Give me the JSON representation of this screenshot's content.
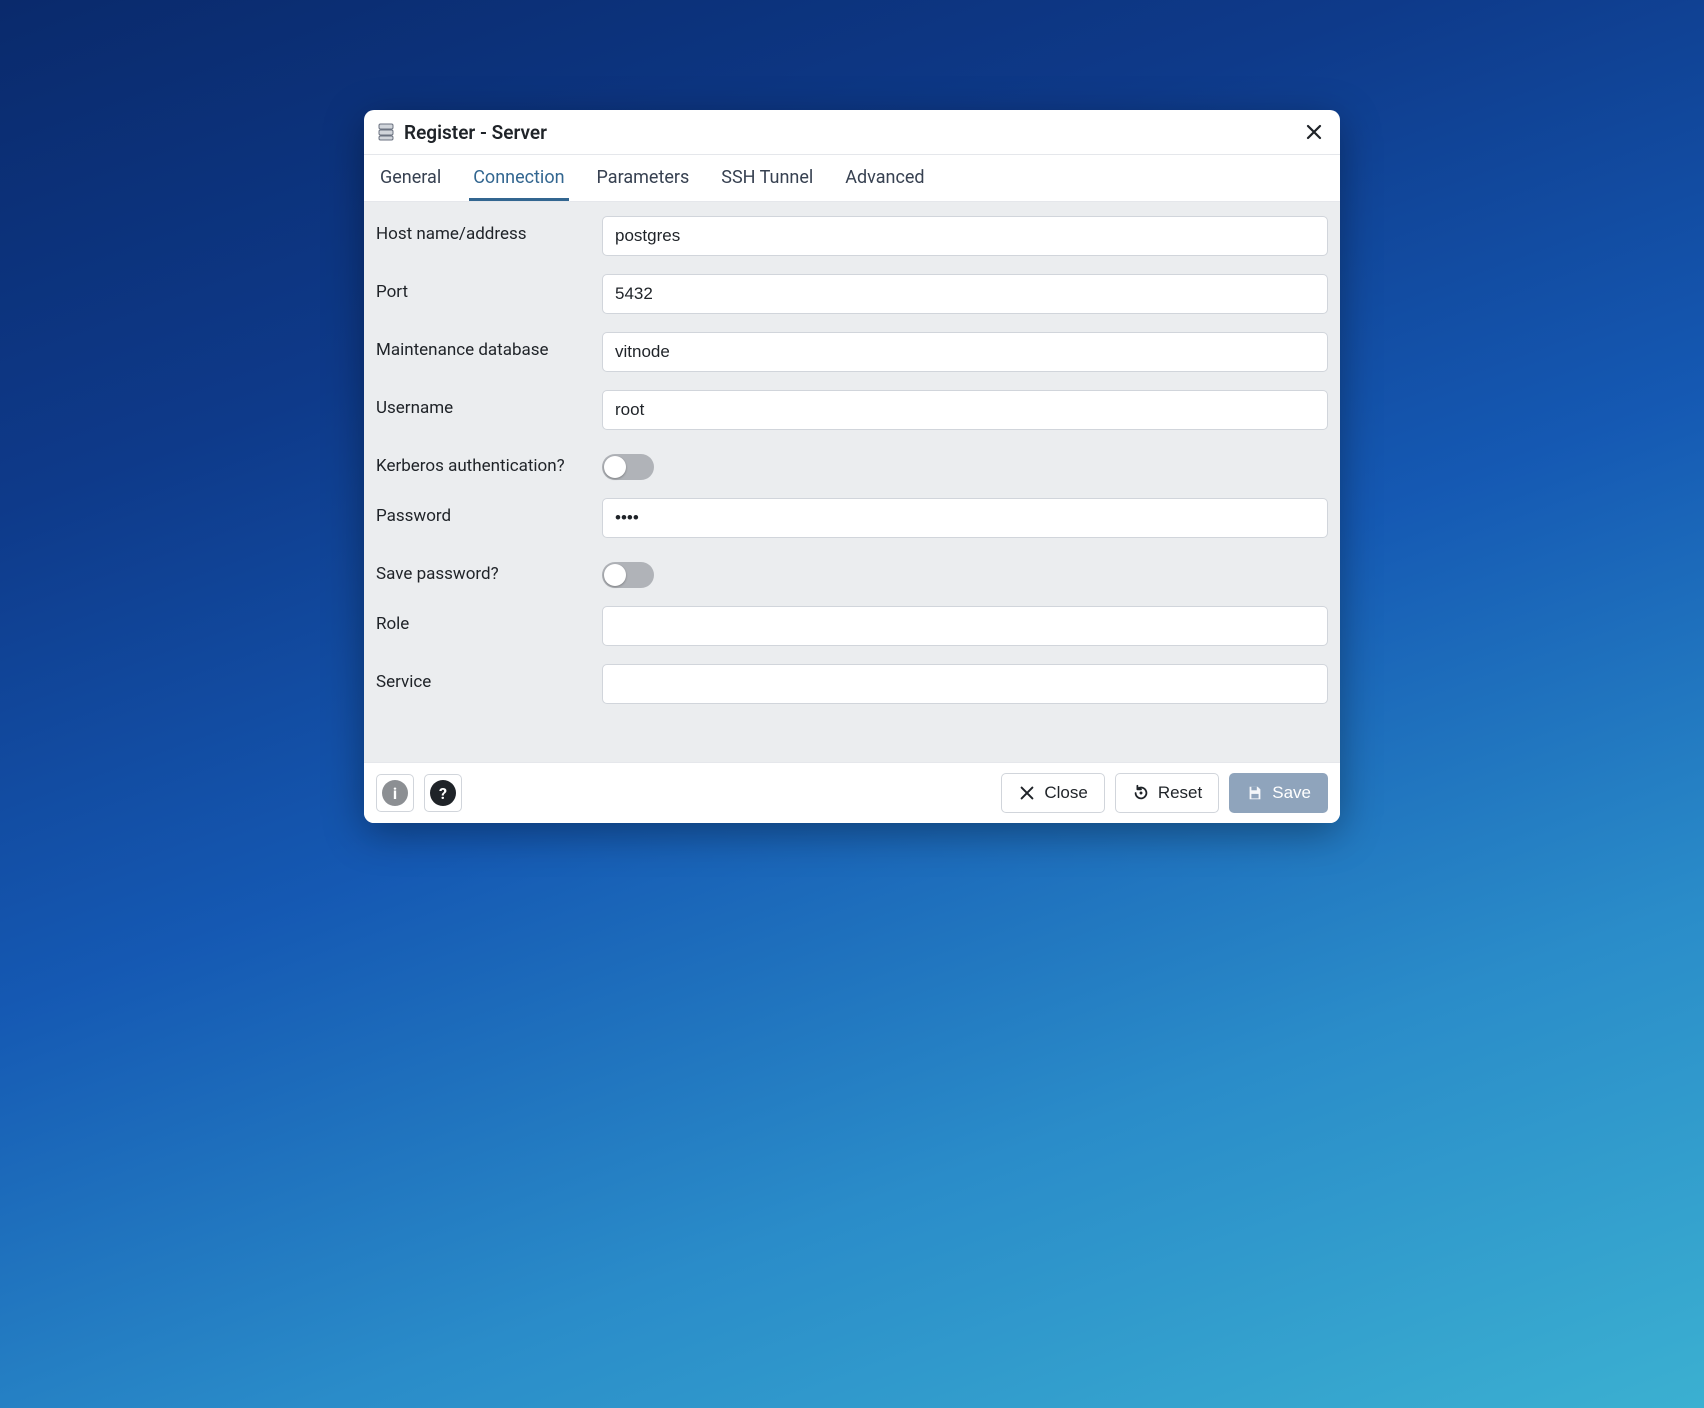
{
  "dialog": {
    "title": "Register - Server"
  },
  "tabs": [
    {
      "id": "general",
      "label": "General",
      "active": false
    },
    {
      "id": "connection",
      "label": "Connection",
      "active": true
    },
    {
      "id": "parameters",
      "label": "Parameters",
      "active": false
    },
    {
      "id": "sshtunnel",
      "label": "SSH Tunnel",
      "active": false
    },
    {
      "id": "advanced",
      "label": "Advanced",
      "active": false
    }
  ],
  "form": {
    "host": {
      "label": "Host name/address",
      "value": "postgres"
    },
    "port": {
      "label": "Port",
      "value": "5432"
    },
    "maintdb": {
      "label": "Maintenance database",
      "value": "vitnode"
    },
    "username": {
      "label": "Username",
      "value": "root"
    },
    "kerberos": {
      "label": "Kerberos authentication?",
      "value": false
    },
    "password": {
      "label": "Password",
      "value": "••••"
    },
    "savepw": {
      "label": "Save password?",
      "value": false
    },
    "role": {
      "label": "Role",
      "value": ""
    },
    "service": {
      "label": "Service",
      "value": ""
    }
  },
  "footer": {
    "close": "Close",
    "reset": "Reset",
    "save": "Save"
  }
}
